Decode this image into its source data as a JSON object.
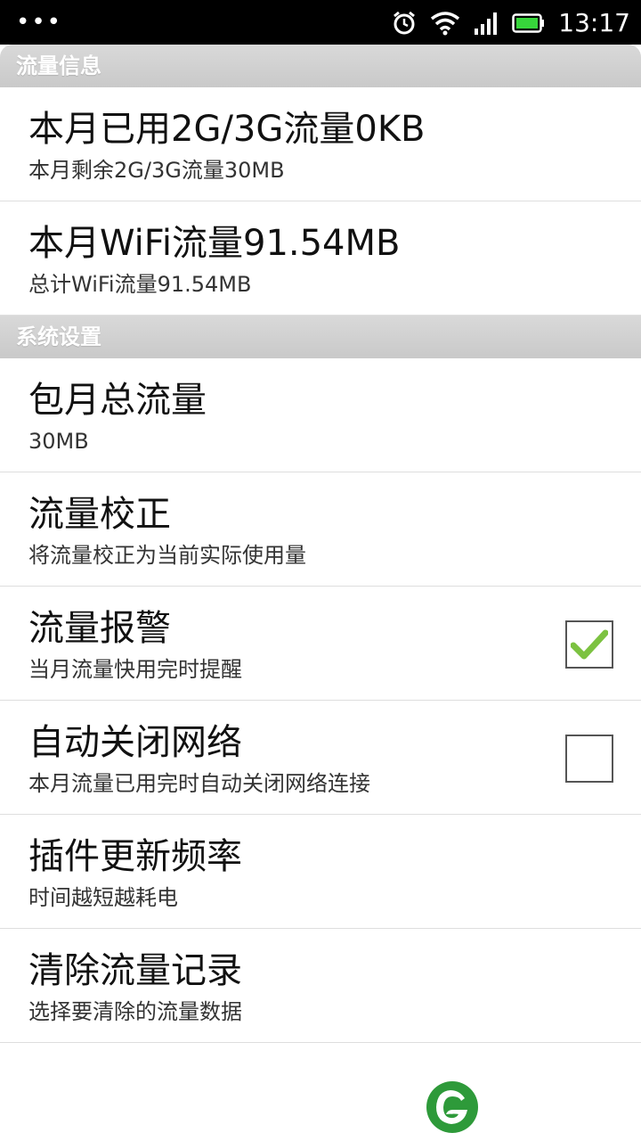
{
  "status_bar": {
    "time": "13:17",
    "icons": [
      "alarm-icon",
      "wifi-icon",
      "signal-icon",
      "battery-icon"
    ],
    "overflow": "•••"
  },
  "sections": [
    {
      "header": "流量信息",
      "items": [
        {
          "title": "本月已用2G/3G流量0KB",
          "subtitle": "本月剩余2G/3G流量30MB"
        },
        {
          "title": "本月WiFi流量91.54MB",
          "subtitle": "总计WiFi流量91.54MB"
        }
      ]
    },
    {
      "header": "系统设置",
      "items": [
        {
          "title": "包月总流量",
          "subtitle": "30MB"
        },
        {
          "title": "流量校正",
          "subtitle": "将流量校正为当前实际使用量"
        },
        {
          "title": "流量报警",
          "subtitle": "当月流量快用完时提醒",
          "checked": true
        },
        {
          "title": "自动关闭网络",
          "subtitle": "本月流量已用完时自动关闭网络连接",
          "checked": false
        },
        {
          "title": "插件更新频率",
          "subtitle": "时间越短越耗电"
        },
        {
          "title": "清除流量记录",
          "subtitle": "选择要清除的流量数据"
        }
      ]
    }
  ],
  "colors": {
    "accent": "#2e9a3a",
    "header_bg": "#d0d0d0",
    "check": "#7cc241"
  }
}
